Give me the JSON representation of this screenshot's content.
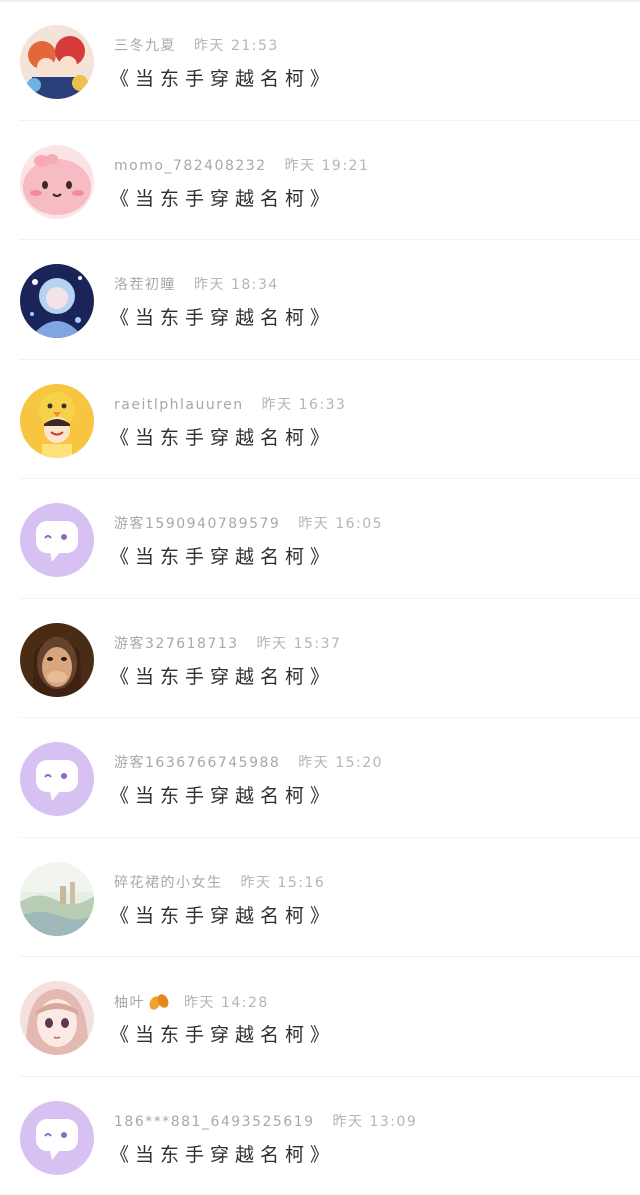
{
  "messages": [
    {
      "name": "三冬九夏",
      "time": "昨天 21:53",
      "text": "《当东手穿越名柯》",
      "avatar_icon": "anime-group-avatar-icon"
    },
    {
      "name": "momo_782408232",
      "time": "昨天 19:21",
      "text": "《当东手穿越名柯》",
      "avatar_icon": "pink-blob-avatar-icon"
    },
    {
      "name": "洛茬初瞳",
      "time": "昨天 18:34",
      "text": "《当东手穿越名柯》",
      "avatar_icon": "anime-girl-avatar-icon"
    },
    {
      "name": "raeitlphlauuren",
      "time": "昨天 16:33",
      "text": "《当东手穿越名柯》",
      "avatar_icon": "chick-hat-avatar-icon"
    },
    {
      "name": "游客1590940789579",
      "time": "昨天 16:05",
      "text": "《当东手穿越名柯》",
      "avatar_icon": "guest-chat-bubble-icon"
    },
    {
      "name": "游客327618713",
      "time": "昨天 15:37",
      "text": "《当东手穿越名柯》",
      "avatar_icon": "photo-avatar-icon"
    },
    {
      "name": "游客1636766745988",
      "time": "昨天 15:20",
      "text": "《当东手穿越名柯》",
      "avatar_icon": "guest-chat-bubble-icon"
    },
    {
      "name": "碎花裙的小女生",
      "time": "昨天 15:16",
      "text": "《当东手穿越名柯》",
      "avatar_icon": "landscape-avatar-icon"
    },
    {
      "name": "柚叶",
      "time": "昨天 14:28",
      "text": "《当东手穿越名柯》",
      "avatar_icon": "anime-face-avatar-icon",
      "name_badge_icon": "leaf-emoji-icon"
    },
    {
      "name": "186***881_6493525619",
      "time": "昨天 13:09",
      "text": "《当东手穿越名柯》",
      "avatar_icon": "guest-chat-bubble-icon"
    }
  ],
  "colors": {
    "guest_avatar_bg": "#d7c1f2",
    "message_text": "#2f2f2f",
    "meta_text": "#a8a8a8"
  }
}
